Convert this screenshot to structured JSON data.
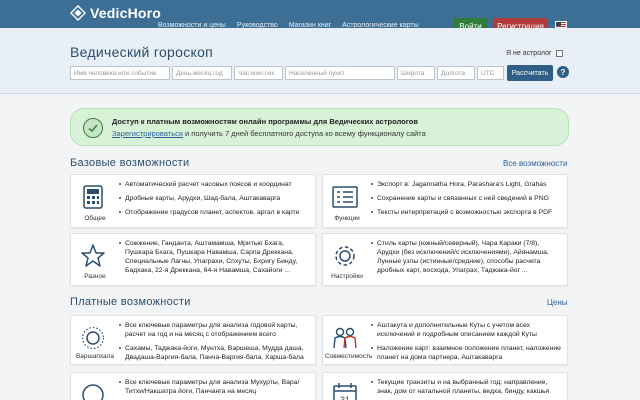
{
  "header": {
    "logo_text": "VedicHoro",
    "nav": [
      "Возможности и цены",
      "Руководство",
      "Магазин книг",
      "Астрологические карты"
    ],
    "login": "Войти",
    "register": "Регистрация"
  },
  "search": {
    "title": "Ведический гороскоп",
    "not_astrologer": "Я не астролог",
    "name_ph": "Имя человека или событие",
    "date_ph": "День.месяц.год",
    "time_ph": "Час:мин:сек",
    "place_ph": "Населенный пункт",
    "lat_ph": "Широта",
    "lon_ph": "Долгота",
    "utc_ph": "UTC",
    "calc_btn": "Рассчитать",
    "help": "?"
  },
  "promo": {
    "title": "Доступ к платным возможностям онлайн программы для Ведических астрологов",
    "link": "Зарегистрироваться",
    "text": " и получить 7 дней бесплатного доступа ко всему функционалу сайта"
  },
  "basic": {
    "title": "Базовые возможности",
    "link": "Все возможности",
    "cards": [
      {
        "label": "Общее",
        "items": [
          "Автоматический расчет часовых поясов и координат",
          "Дробные карты, Арудхи, Шад-бала, Аштакаварга",
          "Отображение градусов планет, аспектов, аргал в карте"
        ]
      },
      {
        "label": "Функции",
        "items": [
          "Экспорт в: Jagannatha Hora, Parashara's Light, Grahas",
          "Сохранение карты и связанных с ней сведений в PNG",
          "Тексты интерпретаций с возможностью экспорта в PDF"
        ]
      },
      {
        "label": "Разное",
        "items": [
          "Сожжение, Ганданта, Аштамамша, Мритью Бхага, Пушкара Бхага, Пушкара Навамша, Сарпа Дреккана, Специальные Лагны, Упаграхи, Спхуты, Бхригу Бинду, Бадхака, 22-я Дреккана, 64-я Навамша, Сахайоги ..."
        ]
      },
      {
        "label": "Настройки",
        "items": [
          "Стиль карты (южный/северный), Чара Караки (7/8), Арудхи (без исключений/с исключениями), Айянамша, Лунные узлы (истинные/средние), способы расчета дробных карт, восхода, Упаграх, Таджака-йог ..."
        ]
      }
    ]
  },
  "paid": {
    "title": "Платные возможности",
    "link": "Цены",
    "cards": [
      {
        "label": "Варшапхала",
        "items": [
          "Все ключевые параметры для анализа годовой карты, расчет на год и на месяц с отображением всего",
          "Сахамы, Таджака-йоги, Мунтха, Варшеша, Мудда даша, Двадаша-Варгия-бала, Панча-Варгия-бала, Харша-бала"
        ]
      },
      {
        "label": "Совместимость",
        "items": [
          "Аштакута и дополнительные Куты с учетом всех исключений и подробным описанием каждой Куты",
          "Наложение карт: взаимное положение планет, наложение планет на дома партнера, Аштакаварга"
        ]
      },
      {
        "label": "",
        "items": [
          "Все ключевые параметры для анализа Мухурты, Вара/Титхи/Накшатра йоги, Панчанга на месяц"
        ]
      },
      {
        "label": "",
        "items": [
          "Текущие транзиты и на выбранный год: направление, знак, дом от натальной планеты, ведха, бинду, какшья"
        ]
      }
    ]
  },
  "colors": {
    "header_bg": "#3d6f96",
    "login_bg": "#2e7d3b",
    "register_bg": "#b23a3a",
    "promo_bg": "#d8f2d8",
    "heading": "#2b4e6e"
  },
  "icons": [
    "diamond-logo-icon",
    "calculator-icon",
    "checklist-icon",
    "star-icon",
    "gear-icon",
    "sun-icon",
    "couple-icon",
    "calendar-icon"
  ],
  "calendar_day": "31"
}
